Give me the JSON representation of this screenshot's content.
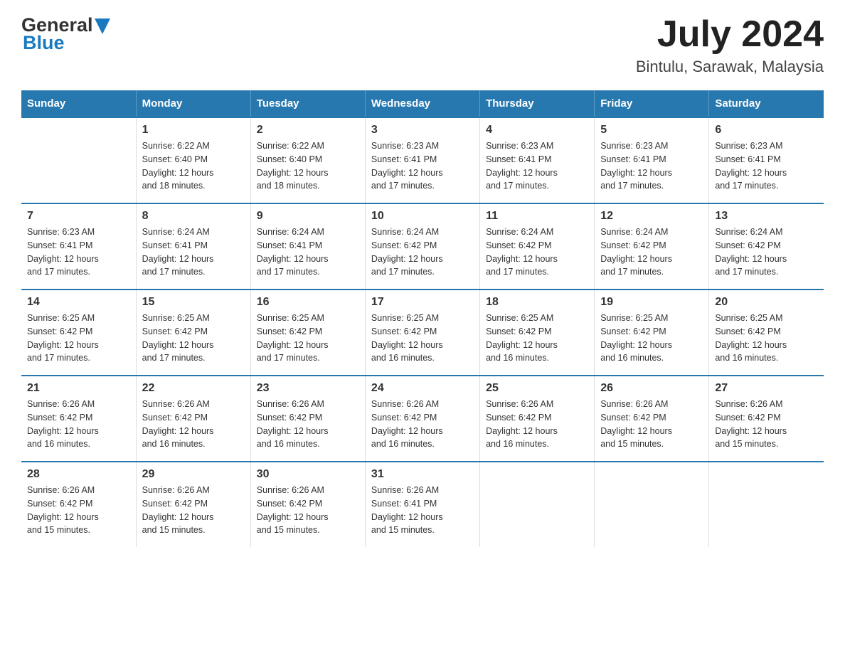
{
  "header": {
    "logo_general": "General",
    "logo_blue": "Blue",
    "title": "July 2024",
    "subtitle": "Bintulu, Sarawak, Malaysia"
  },
  "calendar": {
    "days_of_week": [
      "Sunday",
      "Monday",
      "Tuesday",
      "Wednesday",
      "Thursday",
      "Friday",
      "Saturday"
    ],
    "weeks": [
      [
        {
          "day": "",
          "info": ""
        },
        {
          "day": "1",
          "info": "Sunrise: 6:22 AM\nSunset: 6:40 PM\nDaylight: 12 hours\nand 18 minutes."
        },
        {
          "day": "2",
          "info": "Sunrise: 6:22 AM\nSunset: 6:40 PM\nDaylight: 12 hours\nand 18 minutes."
        },
        {
          "day": "3",
          "info": "Sunrise: 6:23 AM\nSunset: 6:41 PM\nDaylight: 12 hours\nand 17 minutes."
        },
        {
          "day": "4",
          "info": "Sunrise: 6:23 AM\nSunset: 6:41 PM\nDaylight: 12 hours\nand 17 minutes."
        },
        {
          "day": "5",
          "info": "Sunrise: 6:23 AM\nSunset: 6:41 PM\nDaylight: 12 hours\nand 17 minutes."
        },
        {
          "day": "6",
          "info": "Sunrise: 6:23 AM\nSunset: 6:41 PM\nDaylight: 12 hours\nand 17 minutes."
        }
      ],
      [
        {
          "day": "7",
          "info": "Sunrise: 6:23 AM\nSunset: 6:41 PM\nDaylight: 12 hours\nand 17 minutes."
        },
        {
          "day": "8",
          "info": "Sunrise: 6:24 AM\nSunset: 6:41 PM\nDaylight: 12 hours\nand 17 minutes."
        },
        {
          "day": "9",
          "info": "Sunrise: 6:24 AM\nSunset: 6:41 PM\nDaylight: 12 hours\nand 17 minutes."
        },
        {
          "day": "10",
          "info": "Sunrise: 6:24 AM\nSunset: 6:42 PM\nDaylight: 12 hours\nand 17 minutes."
        },
        {
          "day": "11",
          "info": "Sunrise: 6:24 AM\nSunset: 6:42 PM\nDaylight: 12 hours\nand 17 minutes."
        },
        {
          "day": "12",
          "info": "Sunrise: 6:24 AM\nSunset: 6:42 PM\nDaylight: 12 hours\nand 17 minutes."
        },
        {
          "day": "13",
          "info": "Sunrise: 6:24 AM\nSunset: 6:42 PM\nDaylight: 12 hours\nand 17 minutes."
        }
      ],
      [
        {
          "day": "14",
          "info": "Sunrise: 6:25 AM\nSunset: 6:42 PM\nDaylight: 12 hours\nand 17 minutes."
        },
        {
          "day": "15",
          "info": "Sunrise: 6:25 AM\nSunset: 6:42 PM\nDaylight: 12 hours\nand 17 minutes."
        },
        {
          "day": "16",
          "info": "Sunrise: 6:25 AM\nSunset: 6:42 PM\nDaylight: 12 hours\nand 17 minutes."
        },
        {
          "day": "17",
          "info": "Sunrise: 6:25 AM\nSunset: 6:42 PM\nDaylight: 12 hours\nand 16 minutes."
        },
        {
          "day": "18",
          "info": "Sunrise: 6:25 AM\nSunset: 6:42 PM\nDaylight: 12 hours\nand 16 minutes."
        },
        {
          "day": "19",
          "info": "Sunrise: 6:25 AM\nSunset: 6:42 PM\nDaylight: 12 hours\nand 16 minutes."
        },
        {
          "day": "20",
          "info": "Sunrise: 6:25 AM\nSunset: 6:42 PM\nDaylight: 12 hours\nand 16 minutes."
        }
      ],
      [
        {
          "day": "21",
          "info": "Sunrise: 6:26 AM\nSunset: 6:42 PM\nDaylight: 12 hours\nand 16 minutes."
        },
        {
          "day": "22",
          "info": "Sunrise: 6:26 AM\nSunset: 6:42 PM\nDaylight: 12 hours\nand 16 minutes."
        },
        {
          "day": "23",
          "info": "Sunrise: 6:26 AM\nSunset: 6:42 PM\nDaylight: 12 hours\nand 16 minutes."
        },
        {
          "day": "24",
          "info": "Sunrise: 6:26 AM\nSunset: 6:42 PM\nDaylight: 12 hours\nand 16 minutes."
        },
        {
          "day": "25",
          "info": "Sunrise: 6:26 AM\nSunset: 6:42 PM\nDaylight: 12 hours\nand 16 minutes."
        },
        {
          "day": "26",
          "info": "Sunrise: 6:26 AM\nSunset: 6:42 PM\nDaylight: 12 hours\nand 15 minutes."
        },
        {
          "day": "27",
          "info": "Sunrise: 6:26 AM\nSunset: 6:42 PM\nDaylight: 12 hours\nand 15 minutes."
        }
      ],
      [
        {
          "day": "28",
          "info": "Sunrise: 6:26 AM\nSunset: 6:42 PM\nDaylight: 12 hours\nand 15 minutes."
        },
        {
          "day": "29",
          "info": "Sunrise: 6:26 AM\nSunset: 6:42 PM\nDaylight: 12 hours\nand 15 minutes."
        },
        {
          "day": "30",
          "info": "Sunrise: 6:26 AM\nSunset: 6:42 PM\nDaylight: 12 hours\nand 15 minutes."
        },
        {
          "day": "31",
          "info": "Sunrise: 6:26 AM\nSunset: 6:41 PM\nDaylight: 12 hours\nand 15 minutes."
        },
        {
          "day": "",
          "info": ""
        },
        {
          "day": "",
          "info": ""
        },
        {
          "day": "",
          "info": ""
        }
      ]
    ]
  }
}
